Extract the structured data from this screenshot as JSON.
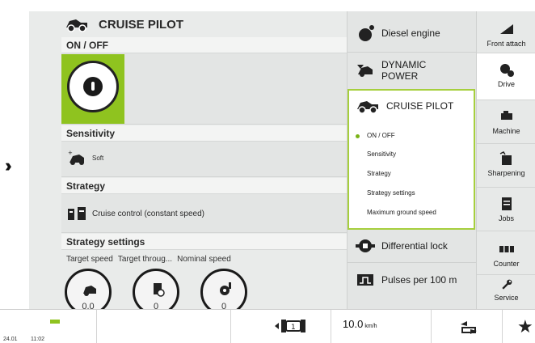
{
  "page": {
    "title": "CRUISE PILOT"
  },
  "main": {
    "onoff_label": "ON / OFF",
    "sensitivity_label": "Sensitivity",
    "sensitivity_value": "Soft",
    "strategy_label": "Strategy",
    "strategy_value": "Cruise control (constant speed)",
    "strategy_settings_label": "Strategy settings",
    "targets": [
      {
        "label": "Target speed",
        "value": "0.0"
      },
      {
        "label": "Target throug...",
        "value": "0"
      },
      {
        "label": "Nominal speed",
        "value": "0"
      }
    ]
  },
  "submenu": {
    "items": [
      {
        "label": "Diesel engine",
        "icon": "engine-icon"
      },
      {
        "label": "DYNAMIC POWER",
        "icon": "dynamic-power-icon"
      },
      {
        "label": "Differential lock",
        "icon": "differential-lock-icon"
      },
      {
        "label": "Pulses per 100 m",
        "icon": "pulses-icon"
      }
    ],
    "card_title": "CRUISE PILOT",
    "options": [
      "ON / OFF",
      "Sensitivity",
      "Strategy",
      "Strategy settings",
      "Maximum ground speed"
    ],
    "selected_option": "ON / OFF"
  },
  "nav": {
    "items": [
      {
        "label": "Front attach",
        "icon": "front-attach-icon"
      },
      {
        "label": "Drive",
        "icon": "drive-icon"
      },
      {
        "label": "Machine",
        "icon": "machine-icon"
      },
      {
        "label": "Sharpening",
        "icon": "sharpening-icon"
      },
      {
        "label": "Jobs",
        "icon": "jobs-icon"
      },
      {
        "label": "Counter",
        "icon": "counter-icon"
      },
      {
        "label": "Service",
        "icon": "service-icon"
      }
    ],
    "active": "Drive"
  },
  "status": {
    "date": "24.01",
    "time": "11:02",
    "speed_value": "10.0",
    "speed_unit": "km/h"
  },
  "colors": {
    "accent": "#8fc31f",
    "panel": "#e9ebea"
  }
}
